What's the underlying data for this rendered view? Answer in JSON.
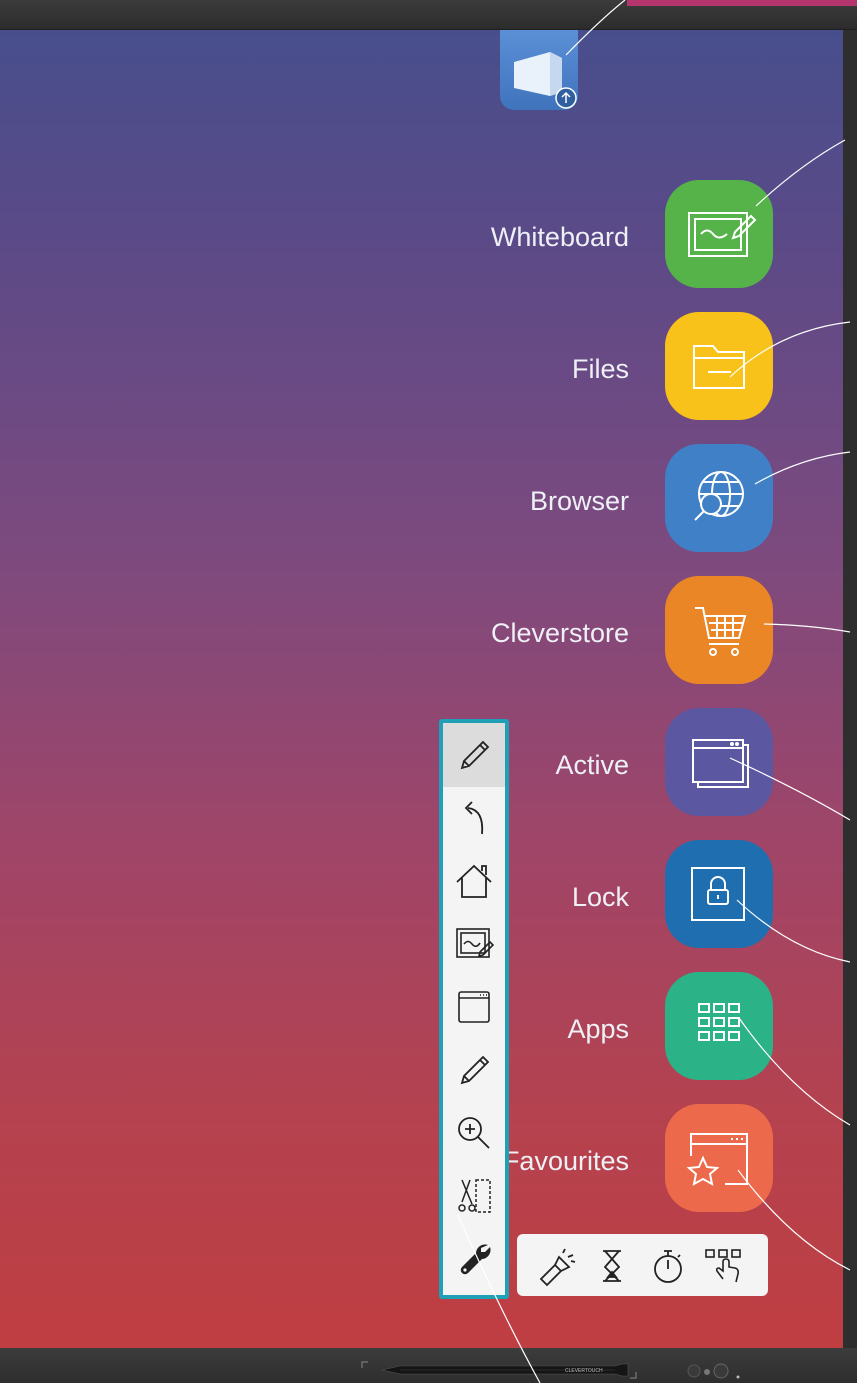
{
  "apps": [
    {
      "label": "Whiteboard",
      "icon": "whiteboard-icon",
      "color": "#55b34a"
    },
    {
      "label": "Files",
      "icon": "folder-icon",
      "color": "#f8c21a"
    },
    {
      "label": "Browser",
      "icon": "globe-search-icon",
      "color": "#3f80c6"
    },
    {
      "label": "Cleverstore",
      "icon": "cart-icon",
      "color": "#ea8626"
    },
    {
      "label": "Active",
      "icon": "window-icon",
      "color": "#5b57a0"
    },
    {
      "label": "Lock",
      "icon": "lock-icon",
      "color": "#1f6fb0"
    },
    {
      "label": "Apps",
      "icon": "grid-icon",
      "color": "#2bb287"
    },
    {
      "label": "Favourites",
      "icon": "star-window-icon",
      "color": "#ec6a4b"
    }
  ],
  "toolbar": [
    {
      "icon": "pencil-icon",
      "selected": true
    },
    {
      "icon": "back-arrow-icon"
    },
    {
      "icon": "home-icon"
    },
    {
      "icon": "whiteboard-icon"
    },
    {
      "icon": "window-icon"
    },
    {
      "icon": "pencil-icon"
    },
    {
      "icon": "zoom-in-icon"
    },
    {
      "icon": "snip-icon"
    },
    {
      "icon": "wrench-icon"
    }
  ],
  "subtray": [
    {
      "icon": "spotlight-icon"
    },
    {
      "icon": "hourglass-icon"
    },
    {
      "icon": "stopwatch-icon"
    },
    {
      "icon": "touch-grid-icon"
    }
  ],
  "pen_brand": "CLEVERTOUCH",
  "colors": {
    "toolbar_border": "#1ea0b6",
    "top_icon": "#4a80c8"
  }
}
